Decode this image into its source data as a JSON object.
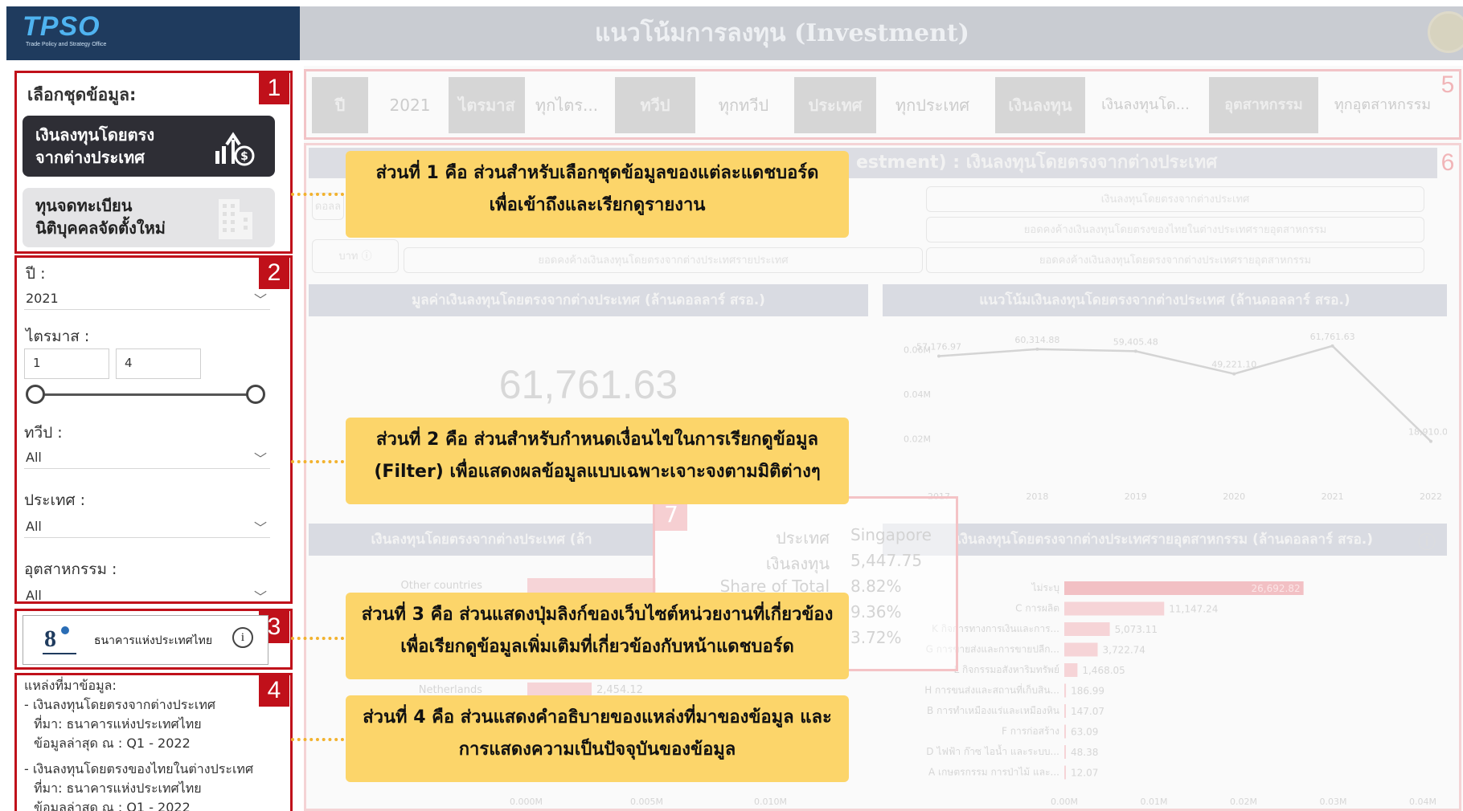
{
  "header": {
    "logo_text": "TPSO",
    "logo_subtext": "Trade Policy and Strategy Office",
    "title": "แนวโน้มการลงทุน (Investment)"
  },
  "sidebar": {
    "section1": {
      "badge": "1",
      "label": "เลือกชุดข้อมูล:",
      "button_fdi_line1": "เงินลงทุนโดยตรง",
      "button_fdi_line2": "จากต่างประเทศ",
      "button_capital_line1": "ทุนจดทะเบียน",
      "button_capital_line2": "นิติบุคคลจัดตั้งใหม่"
    },
    "section2": {
      "badge": "2",
      "year_label": "ปี :",
      "year_value": "2021",
      "quarter_label": "ไตรมาส :",
      "quarter_from": "1",
      "quarter_to": "4",
      "continent_label": "ทวีป :",
      "continent_value": "All",
      "country_label": "ประเทศ :",
      "country_value": "All",
      "industry_label": "อุตสาหกรรม :",
      "industry_value": "All"
    },
    "section3": {
      "badge": "3",
      "bank_name": "ธนาคารแห่งประเทศไทย",
      "info_icon": "i"
    },
    "section4": {
      "badge": "4",
      "heading": "แหล่งที่มาข้อมูล:",
      "item1_line1": "- เงินลงทุนโดยตรงจากต่างประเทศ",
      "item1_line2": "ที่มา: ธนาคารแห่งประเทศไทย",
      "item1_line3": "ข้อมูลล่าสุด ณ : Q1 - 2022",
      "item2_line1": "- เงินลงทุนโดยตรงของไทยในต่างประเทศ",
      "item2_line2": "ที่มา: ธนาคารแห่งประเทศไทย",
      "item2_line3": "ข้อมูลล่าสุด ณ : Q1 - 2022"
    }
  },
  "dashboard": {
    "badge5": "5",
    "badge6": "6",
    "badge7": "7",
    "slicers": [
      {
        "label": "ปี",
        "value": "2021"
      },
      {
        "label": "ไตรมาส",
        "value": "ทุกไตร..."
      },
      {
        "label": "ทวีป",
        "value": "ทุกทวีป"
      },
      {
        "label": "ประเทศ",
        "value": "ทุกประเทศ"
      },
      {
        "label": "เงินลงทุน",
        "value": "เงินลงทุนโด..."
      },
      {
        "label": "อุตสาหกรรม",
        "value": "ทุกอุตสาหกรรม"
      }
    ],
    "section_title": "estment) : เงินลงทุนโดยตรงจากต่างประเทศ",
    "unit_dollar": "ดอลล",
    "unit_baht": "บาท",
    "pill_fdi": "เงินลงทุนโดยตรงจากต่างประเทศ",
    "pill_thai_outward": "ยอดคงค้างเงินลงทุนโดยตรงของไทยในต่างประเทศรายอุตสาหกรรม",
    "pill_country": "ยอดคงค้างเงินลงทุนโดยตรงจากต่างประเทศรายประเทศ",
    "pill_industry": "ยอดคงค้างเงินลงทุนโดยตรงจากต่างประเทศรายอุตสาหกรรม",
    "kpi_title": "มูลค่าเงินลงทุนโดยตรงจากต่างประเทศ (ล้านดอลลาร์ สรอ.)",
    "kpi_value": "61,761.63",
    "trend_title": "แนวโน้มเงินลงทุนโดยตรงจากต่างประเทศ (ล้านดอลลาร์ สรอ.)",
    "country_title": "เงินลงทุนโดยตรงจากต่างประเทศ (ล้า",
    "industry_title": "เงินลงทุนโดยตรงจากต่างประเทศรายอุตสาหกรรม (ล้านดอลลาร์ สรอ.)",
    "country_bar_other": "Other countries",
    "country_bar_nl": "Netherlands",
    "country_bar_nl_value": "2,454.12",
    "country_axis": [
      "0.000M",
      "0.005M",
      "0.010M"
    ],
    "tooltip": {
      "country_label": "ประเทศ",
      "country_value": "Singapore",
      "invest_label": "เงินลงทุน",
      "invest_value": "5,447.75",
      "share_label": "Share of Total",
      "share_value": "8.82%",
      "extra1": "9.36%",
      "extra2": "3.72%"
    },
    "industry_axis": [
      "0.00M",
      "0.01M",
      "0.02M",
      "0.03M",
      "0.04M"
    ]
  },
  "chart_data": [
    {
      "type": "line",
      "title": "แนวโน้มเงินลงทุนโดยตรงจากต่างประเทศ (ล้านดอลลาร์ สรอ.)",
      "x": [
        "2017",
        "2018",
        "2019",
        "2020",
        "2021",
        "2022"
      ],
      "y": [
        57176.97,
        60314.88,
        59405.48,
        49221.1,
        61761.63,
        18910.08
      ],
      "y_labels": [
        "57,176.97",
        "60,314.88",
        "59,405.48",
        "49,221.10",
        "61,761.63",
        "18,910.08"
      ],
      "y_ticks": [
        "0.06M",
        "0.04M",
        "0.02M"
      ],
      "ylim": [
        0,
        70000
      ],
      "grid": false
    },
    {
      "type": "bar",
      "orientation": "horizontal",
      "title": "เงินลงทุนโดยตรงจากต่างประเทศรายอุตสาหกรรม (ล้านดอลลาร์ สรอ.)",
      "categories": [
        "ไม่ระบุ",
        "C การผลิต",
        "K กิจการทางการเงินและการ...",
        "G การขายส่งและการขายปลีก...",
        "L กิจกรรมอสังหาริมทรัพย์",
        "H การขนส่งและสถานที่เก็บสิน...",
        "B การทำเหมืองแร่และเหมืองหิน",
        "F การก่อสร้าง",
        "D ไฟฟ้า ก๊าซ ไอน้ำ และระบบ...",
        "A เกษตรกรรม การป่าไม้ และ..."
      ],
      "values": [
        26692.82,
        11147.24,
        5073.11,
        3722.74,
        1468.05,
        186.99,
        147.07,
        63.09,
        48.38,
        12.07
      ],
      "value_labels": [
        "26,692.82",
        "11,147.24",
        "5,073.11",
        "3,722.74",
        "1,468.05",
        "186.99",
        "147.07",
        "63.09",
        "48.38",
        "12.07"
      ],
      "xlim": [
        0,
        40000
      ]
    }
  ],
  "callouts": {
    "c1_line1": "ส่วนที่ 1 คือ ส่วนสำหรับเลือกชุดข้อมูลของแต่ละแดชบอร์ด",
    "c1_line2": "เพื่อเข้าถึงและเรียกดูรายงาน",
    "c2_line1": "ส่วนที่ 2 คือ ส่วนสำหรับกำหนดเงื่อนไขในการเรียกดูข้อมูล",
    "c2_line2": "(Filter) เพื่อแสดงผลข้อมูลแบบเฉพาะเจาะจงตามมิติต่างๆ",
    "c3_line1": "ส่วนที่ 3 คือ ส่วนแสดงปุ่มลิงก์ของเว็บไซต์หน่วยงานที่เกี่ยวข้อง",
    "c3_line2": "เพื่อเรียกดูข้อมูลเพิ่มเติมที่เกี่ยวข้องกับหน้าแดชบอร์ด",
    "c4_line1": "ส่วนที่ 4 คือ ส่วนแสดงคำอธิบายของแหล่งที่มาของข้อมูล และ",
    "c4_line2": "การแสดงความเป็นปัจจุบันของข้อมูล"
  },
  "colors": {
    "accent_red": "#c0101a",
    "callout_yellow": "#fcd56a",
    "header_navy": "#1f3b5e"
  }
}
